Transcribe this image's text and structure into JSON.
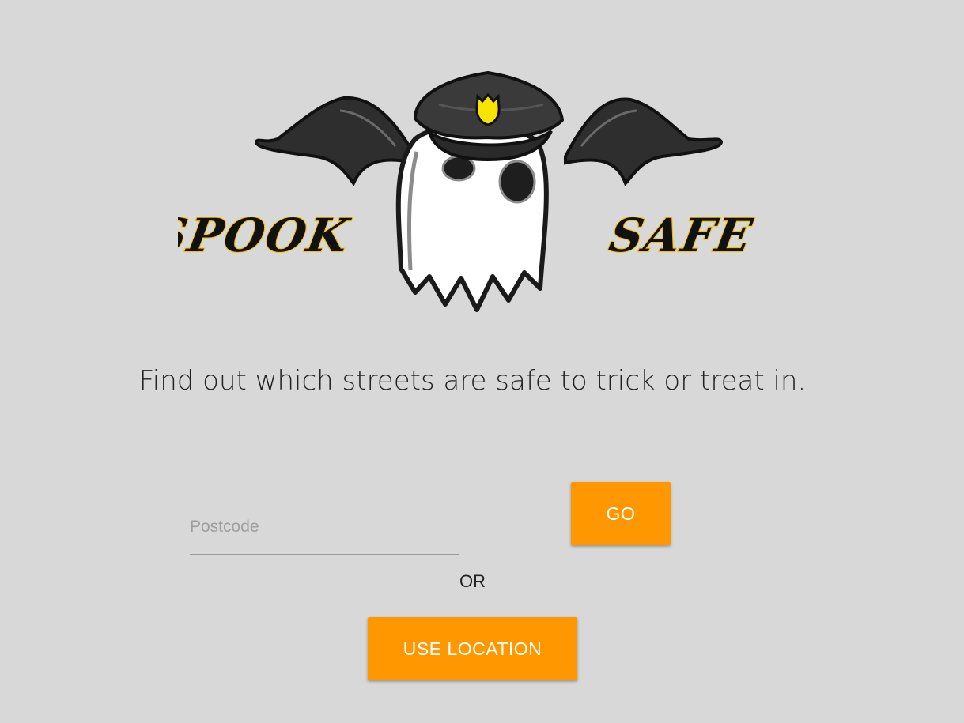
{
  "logo": {
    "word_left": "SPOOK",
    "word_right": "SAFE"
  },
  "tagline": "Find out which streets are safe to trick or treat in.",
  "search": {
    "placeholder": "Postcode",
    "value": "",
    "go_label": "GO"
  },
  "separator": "OR",
  "location_button": "USE LOCATION",
  "colors": {
    "background": "#d8d8d8",
    "accent": "#ff9800",
    "logo_gold": "#f6c200"
  }
}
